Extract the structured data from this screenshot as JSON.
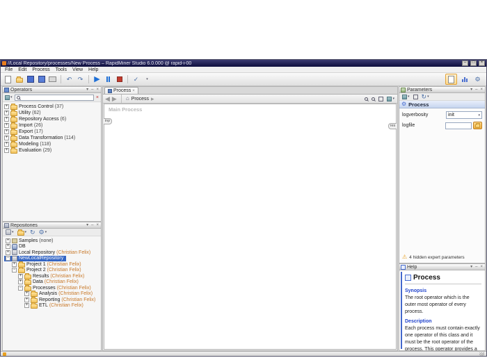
{
  "window": {
    "title": "//Local Repository/processes/New Process – RapidMiner Studio 6.0.000 @ rapid-i-00"
  },
  "menu": {
    "items": [
      "File",
      "Edit",
      "Process",
      "Tools",
      "View",
      "Help"
    ]
  },
  "icons": {
    "minimize": "–",
    "maximize": "□",
    "close": "×",
    "caret_down": "▾",
    "undo": "↶",
    "redo": "↷",
    "run": "▶",
    "back": "◀",
    "forward": "▶",
    "breadcrumb_sep": "▸",
    "home": "⌂",
    "warning": "⚠",
    "expand": "+",
    "collapse": "−",
    "gear": "⚙",
    "check": "✓",
    "refresh": "↻",
    "add": "+"
  },
  "operators": {
    "title": "Operators",
    "search_value": "",
    "items": [
      {
        "label": "Process Control",
        "count": "(37)"
      },
      {
        "label": "Utility",
        "count": "(62)"
      },
      {
        "label": "Repository Access",
        "count": "(6)"
      },
      {
        "label": "Import",
        "count": "(26)"
      },
      {
        "label": "Export",
        "count": "(17)"
      },
      {
        "label": "Data Transformation",
        "count": "(114)"
      },
      {
        "label": "Modeling",
        "count": "(118)"
      },
      {
        "label": "Evaluation",
        "count": "(29)"
      }
    ]
  },
  "repositories": {
    "title": "Repositories",
    "items": [
      {
        "label": "Samples",
        "owner": "(none)"
      },
      {
        "label": "DB",
        "owner": ""
      },
      {
        "label": "Local Repository",
        "owner": "(Christian Felix)"
      },
      {
        "label": "NewLocalRepository",
        "owner": ""
      },
      {
        "label": "Project 1",
        "owner": "(Christian Felix)"
      },
      {
        "label": "Project 2",
        "owner": "(Christian Felix)"
      },
      {
        "label": "Results",
        "owner": "(Christian Felix)"
      },
      {
        "label": "Data",
        "owner": "(Christian Felix)"
      },
      {
        "label": "Processes",
        "owner": "(Christian Felix)"
      },
      {
        "label": "Analysis",
        "owner": "(Christian Felix)"
      },
      {
        "label": "Reporting",
        "owner": "(Christian Felix)"
      },
      {
        "label": "ETL",
        "owner": "(Christian Felix)"
      }
    ]
  },
  "process": {
    "tab": "Process",
    "breadcrumb": "Process",
    "canvas_label": "Main Process",
    "port_in": "inp",
    "port_out": "res"
  },
  "parameters": {
    "title": "Parameters",
    "operator": "Process",
    "rows": [
      {
        "label": "logverbosity",
        "value": "init"
      },
      {
        "label": "logfile",
        "value": ""
      }
    ],
    "hidden_note": "4 hidden expert parameters"
  },
  "help": {
    "title": "Help",
    "operator": "Process",
    "synopsis_label": "Synopsis",
    "synopsis": "The root operator which is the outer most operator of every process.",
    "description_label": "Description",
    "description": "Each process must contain exactly one operator of this class and it must be the root operator of the process. This operator provides a set of parameters"
  }
}
